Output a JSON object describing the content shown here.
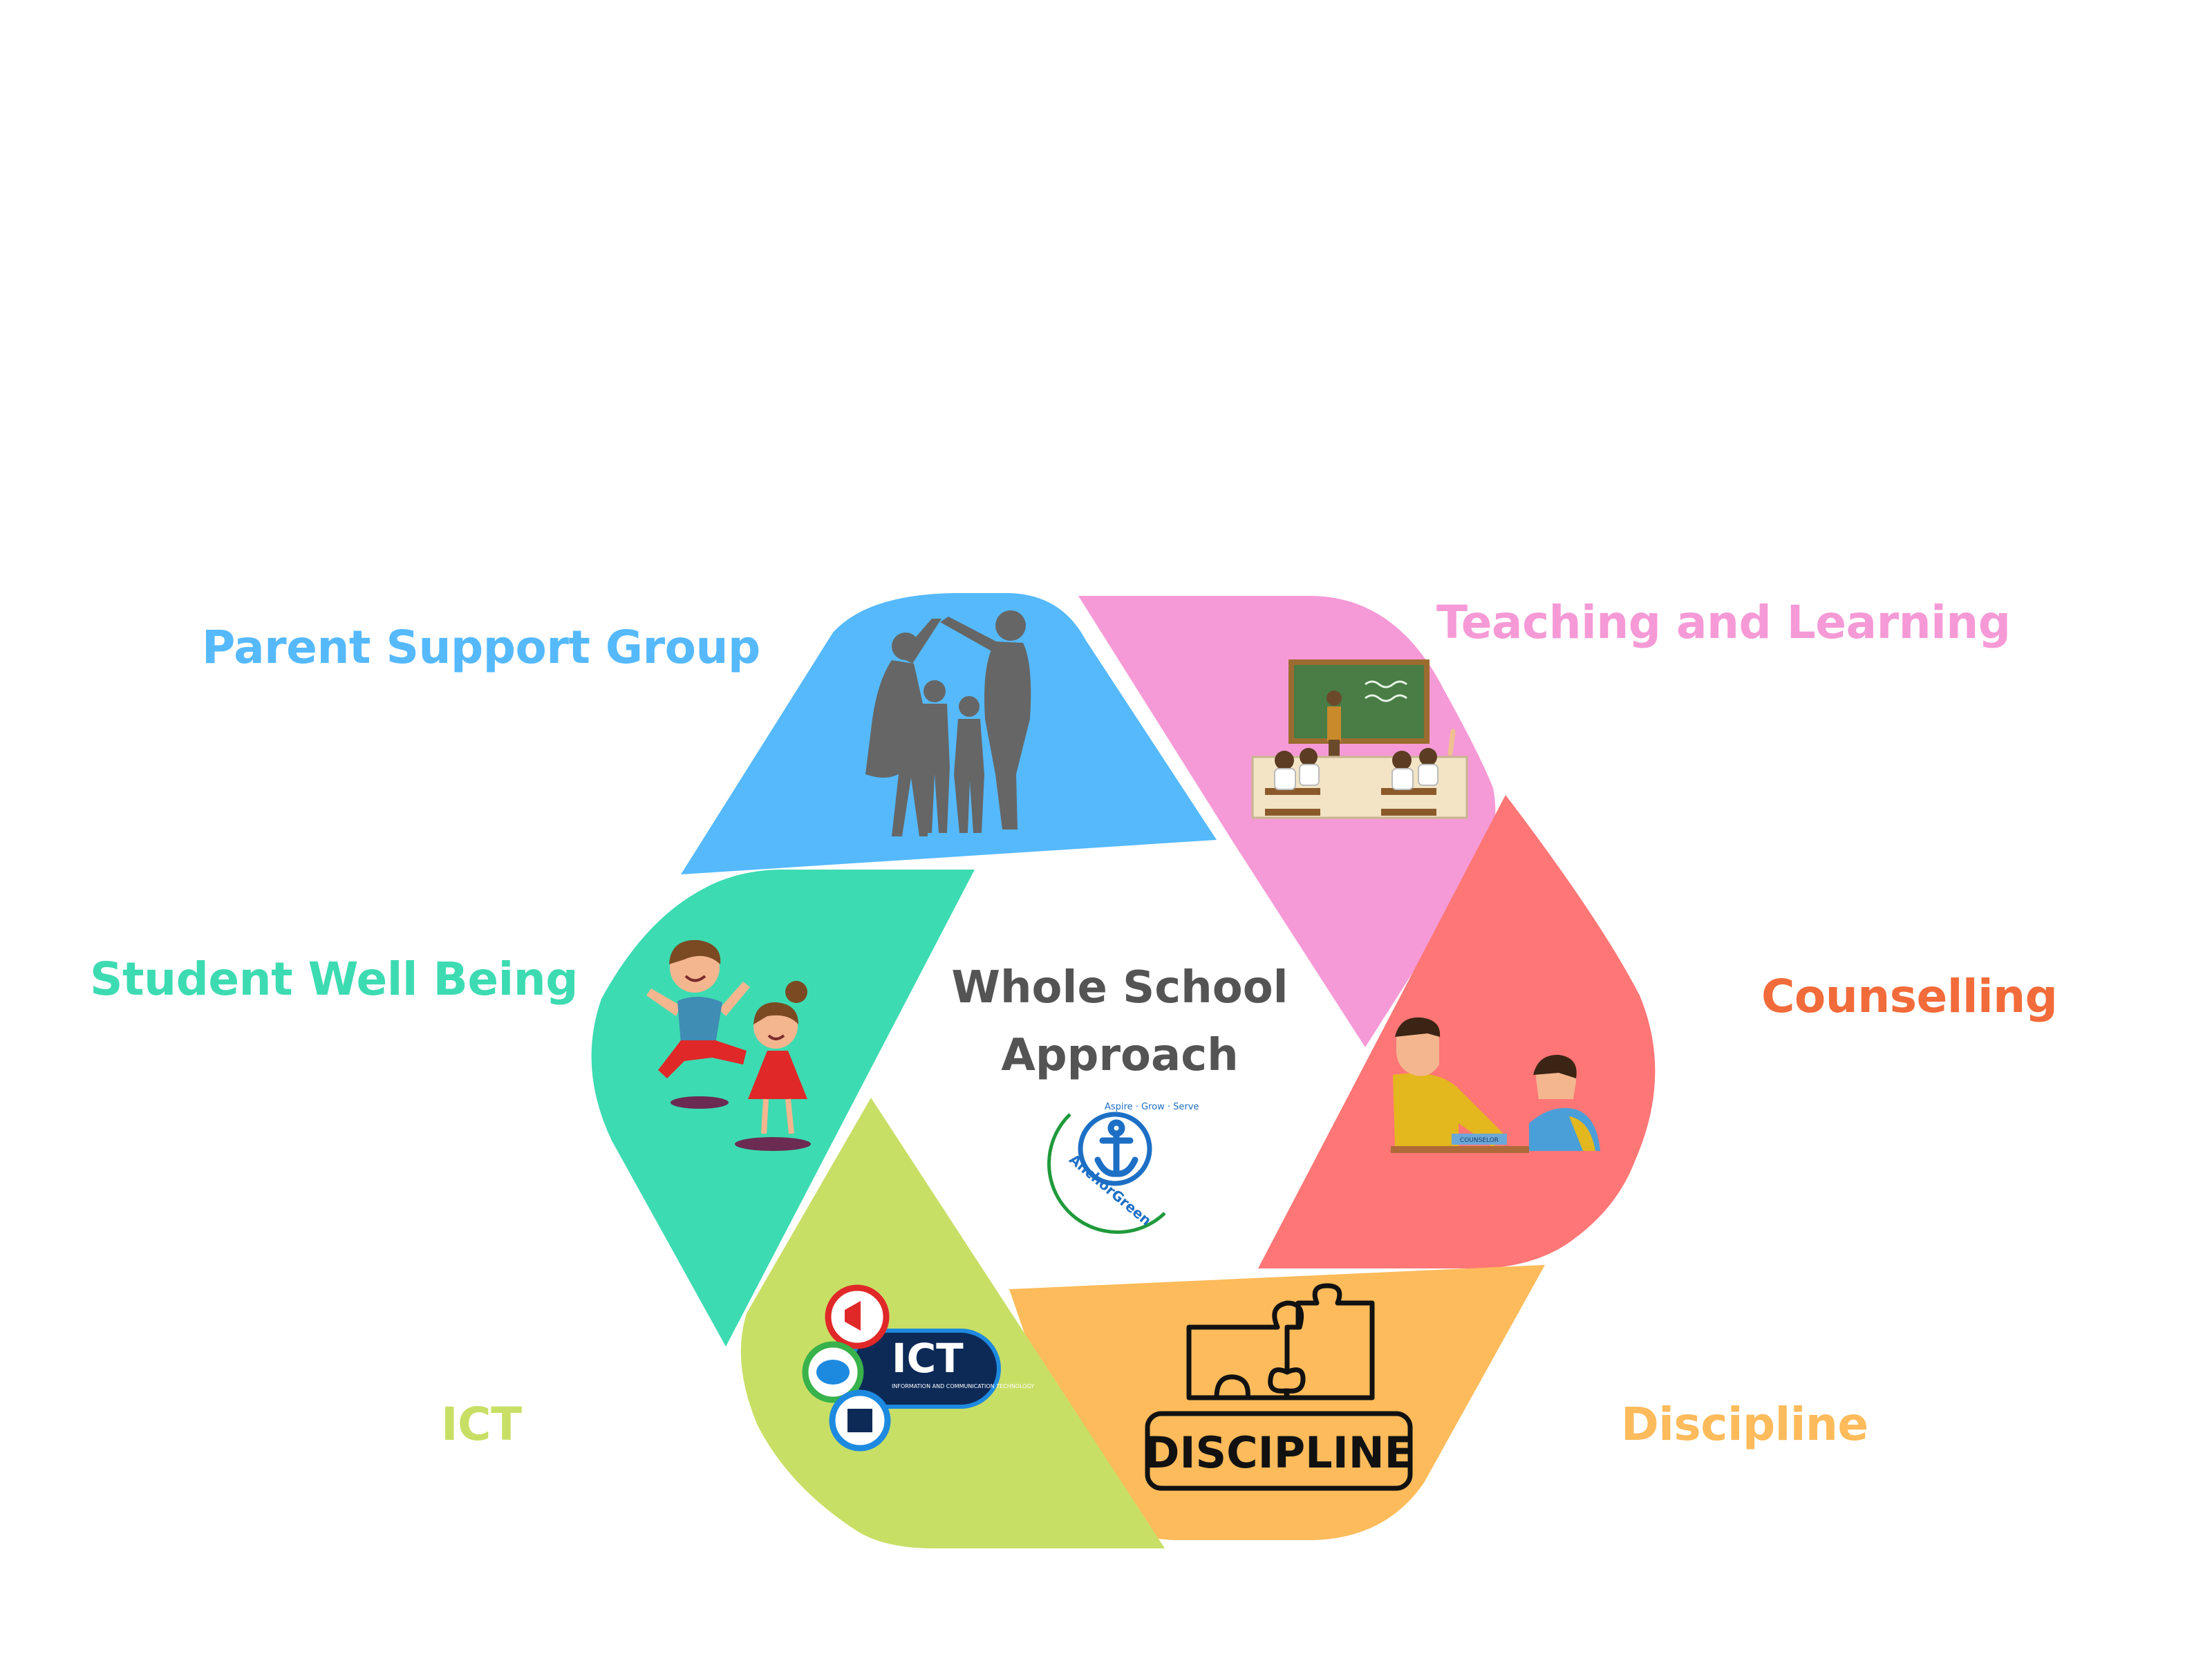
{
  "center": {
    "title_line1": "Whole School",
    "title_line2": "Approach",
    "logo": {
      "top_text": "Aspire · Grow · Serve",
      "name": "AnchorGreen"
    }
  },
  "segments": [
    {
      "id": "parent-support-group",
      "label": "Parent Support Group",
      "color": "#55b9fc",
      "icon": "family-house-silhouette-icon"
    },
    {
      "id": "teaching-and-learning",
      "label": "Teaching and Learning",
      "color": "#f59ad6",
      "icon": "classroom-icon"
    },
    {
      "id": "counselling",
      "label": "Counselling",
      "segment_color": "#fe7676",
      "color": "#f26b3a",
      "icon": "counselling-session-icon",
      "icon_text": "COUNSELOR"
    },
    {
      "id": "discipline",
      "label": "Discipline",
      "color": "#fdbb5b",
      "icon": "discipline-puzzle-icon",
      "icon_text": "DISCIPLINE"
    },
    {
      "id": "ict",
      "label": "ICT",
      "color": "#c8df66",
      "icon": "ict-badge-icon",
      "icon_text": "ICT",
      "icon_subtext": "INFORMATION AND COMMUNICATION TECHNOLOGY"
    },
    {
      "id": "student-well-being",
      "label": "Student Well Being",
      "color": "#3ddbb2",
      "icon": "happy-children-icon"
    }
  ]
}
